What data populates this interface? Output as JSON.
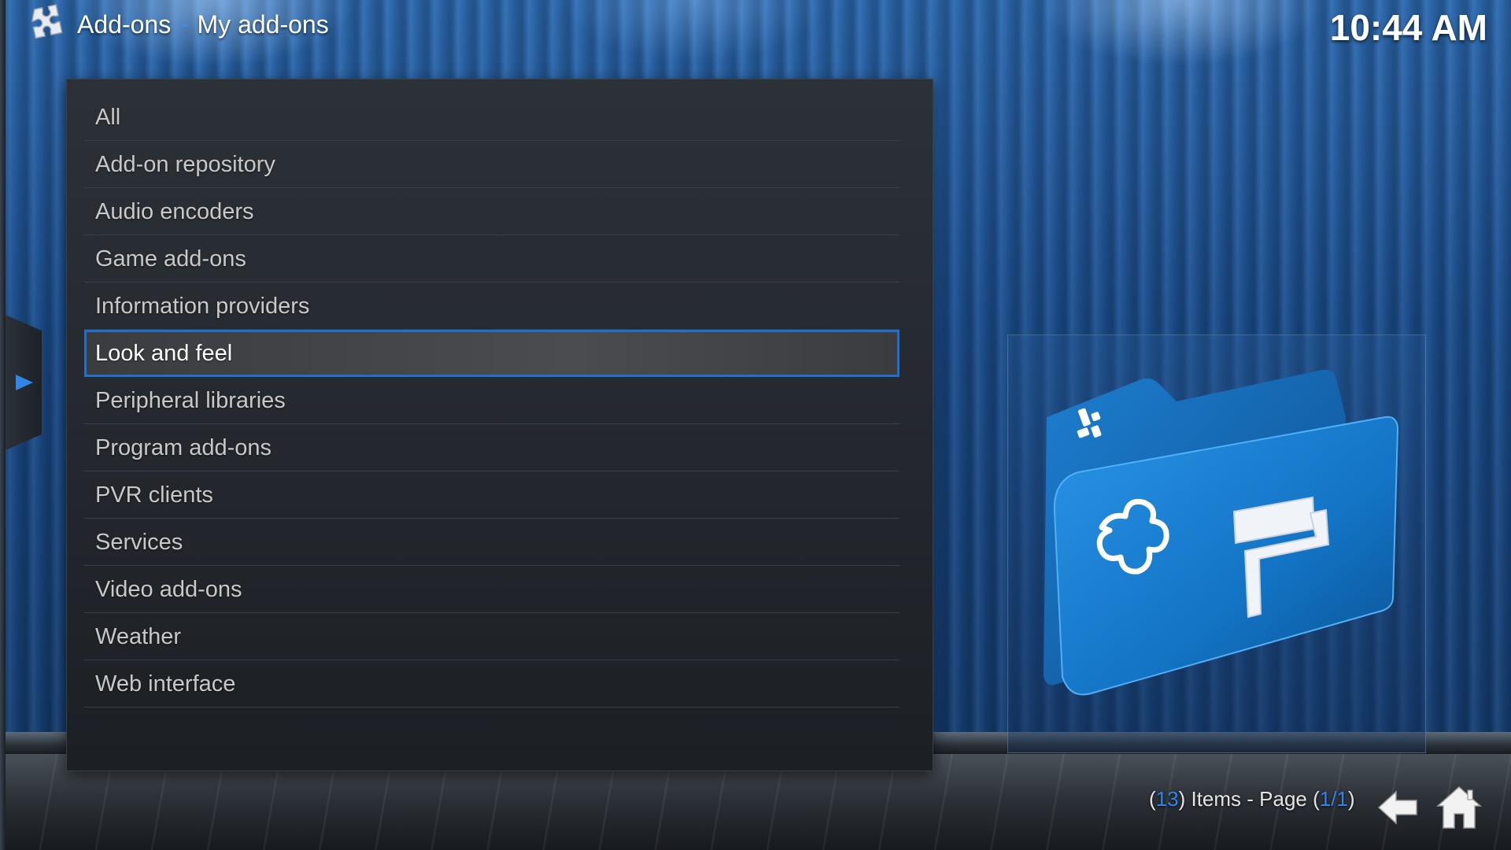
{
  "header": {
    "icon": "puzzle-piece-icon",
    "section": "Add-ons",
    "separator": "-",
    "title": "My add-ons"
  },
  "clock": "10:44 AM",
  "side_tab": {
    "icon": "arrow-right-icon"
  },
  "list": {
    "selected_index": 5,
    "items": [
      {
        "label": "All"
      },
      {
        "label": "Add-on repository"
      },
      {
        "label": "Audio encoders"
      },
      {
        "label": "Game add-ons"
      },
      {
        "label": "Information providers"
      },
      {
        "label": "Look and feel"
      },
      {
        "label": "Peripheral libraries"
      },
      {
        "label": "Program add-ons"
      },
      {
        "label": "PVR clients"
      },
      {
        "label": "Services"
      },
      {
        "label": "Video add-ons"
      },
      {
        "label": "Weather"
      },
      {
        "label": "Web interface"
      }
    ]
  },
  "preview": {
    "icon": "look-and-feel-folder-icon"
  },
  "footer": {
    "open_paren": "(",
    "count": "13",
    "items_text": ") Items - Page (",
    "page": "1/1",
    "close_paren": ")",
    "back_icon": "back-arrow-icon",
    "home_icon": "home-icon"
  },
  "colors": {
    "accent": "#2f86e8",
    "selection_border": "#1f6fd1",
    "text": "#c8c8c8"
  }
}
